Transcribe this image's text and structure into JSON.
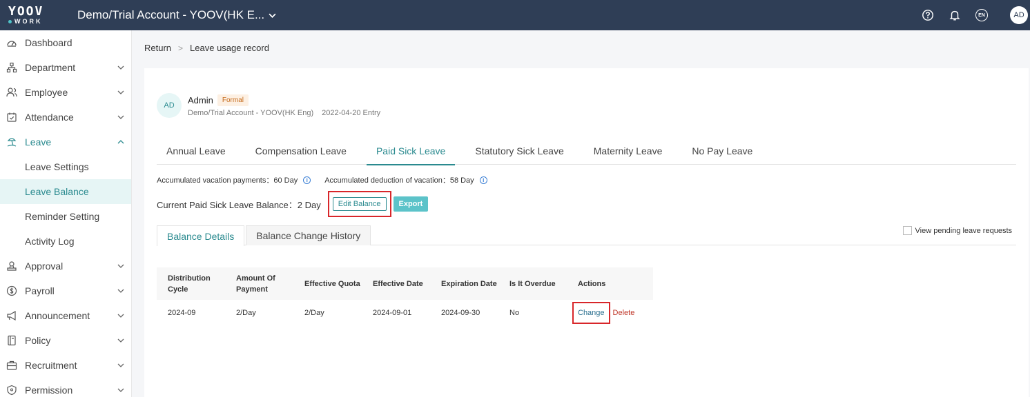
{
  "topbar": {
    "logo_top": "YOOV",
    "logo_bottom": "WORK",
    "account": "Demo/Trial Account - YOOV(HK E...",
    "lang": "EN",
    "avatar": "AD"
  },
  "sidebar": {
    "items": [
      {
        "label": "Dashboard",
        "icon": "dashboard-icon"
      },
      {
        "label": "Department",
        "icon": "department-icon"
      },
      {
        "label": "Employee",
        "icon": "employee-icon"
      },
      {
        "label": "Attendance",
        "icon": "attendance-icon"
      },
      {
        "label": "Leave",
        "icon": "leave-icon"
      },
      {
        "label": "Leave Settings"
      },
      {
        "label": "Leave Balance"
      },
      {
        "label": "Reminder Setting"
      },
      {
        "label": "Activity Log"
      },
      {
        "label": "Approval",
        "icon": "approval-icon"
      },
      {
        "label": "Payroll",
        "icon": "payroll-icon"
      },
      {
        "label": "Announcement",
        "icon": "announcement-icon"
      },
      {
        "label": "Policy",
        "icon": "policy-icon"
      },
      {
        "label": "Recruitment",
        "icon": "recruitment-icon"
      },
      {
        "label": "Permission",
        "icon": "permission-icon"
      }
    ]
  },
  "breadcrumb": {
    "back": "Return",
    "sep": ">",
    "current": "Leave usage record"
  },
  "user": {
    "avatar": "AD",
    "name": "Admin",
    "badge": "Formal",
    "company": "Demo/Trial Account - YOOV(HK Eng)",
    "entry": "2022-04-20 Entry"
  },
  "tabs": [
    "Annual Leave",
    "Compensation Leave",
    "Paid Sick Leave",
    "Statutory Sick Leave",
    "Maternity Leave",
    "No Pay Leave"
  ],
  "stats": {
    "payments": "Accumulated vacation payments：60 Day",
    "deduction": "Accumulated deduction of vacation：58 Day",
    "info": "i"
  },
  "balance": {
    "text": "Current Paid Sick Leave Balance：2 Day",
    "edit": "Edit Balance",
    "export": "Export"
  },
  "subtabs": [
    "Balance Details",
    "Balance Change History"
  ],
  "pending": "View pending leave requests",
  "table": {
    "headers": [
      "Distribution Cycle",
      "Amount Of Payment",
      "Effective Quota",
      "Effective Date",
      "Expiration Date",
      "Is It Overdue",
      "Actions"
    ],
    "rows": [
      {
        "cycle": "2024-09",
        "amount": "2/Day",
        "quota": "2/Day",
        "eff": "2024-09-01",
        "exp": "2024-09-30",
        "overdue": "No",
        "change": "Change",
        "delete": "Delete"
      }
    ]
  },
  "colors": {
    "topbar": "#2f3e56",
    "accent": "#2a8a8f",
    "highlight": "#d8262a"
  }
}
